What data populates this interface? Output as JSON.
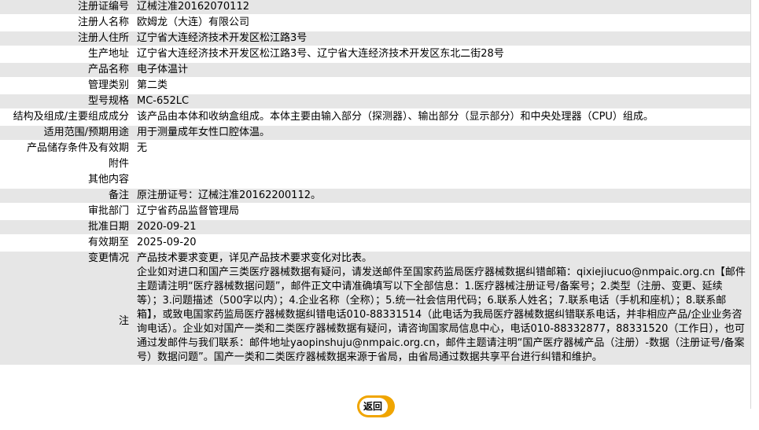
{
  "rows": [
    {
      "key": "注册证编号",
      "value": "辽械注准20162070112"
    },
    {
      "key": "注册人名称",
      "value": "欧姆龙（大连）有限公司"
    },
    {
      "key": "注册人住所",
      "value": "辽宁省大连经济技术开发区松江路3号"
    },
    {
      "key": "生产地址",
      "value": "辽宁省大连经济技术开发区松江路3号、辽宁省大连经济技术开发区东北二街28号"
    },
    {
      "key": "产品名称",
      "value": "电子体温计"
    },
    {
      "key": "管理类别",
      "value": "第二类"
    },
    {
      "key": "型号规格",
      "value": "MC-652LC"
    },
    {
      "key": "结构及组成/主要组成成分",
      "value": "该产品由本体和收纳盒组成。本体主要由输入部分（探测器）、输出部分（显示部分）和中央处理器（CPU）组成。"
    },
    {
      "key": "适用范围/预期用途",
      "value": "用于测量成年女性口腔体温。"
    },
    {
      "key": "产品储存条件及有效期",
      "value": "无"
    },
    {
      "key": "附件",
      "value": ""
    },
    {
      "key": "其他内容",
      "value": ""
    },
    {
      "key": "备注",
      "value": "原注册证号：辽械注准20162200112。"
    },
    {
      "key": "审批部门",
      "value": "辽宁省药品监督管理局"
    },
    {
      "key": "批准日期",
      "value": "2020-09-21"
    },
    {
      "key": "有效期至",
      "value": "2025-09-20"
    }
  ],
  "note": {
    "key": "注",
    "line1": "变更情况",
    "line1_value": "产品技术要求变更，详见产品技术要求变化对比表。",
    "text": "企业如对进口和国产三类医疗器械数据有疑问，请发送邮件至国家药监局医疗器械数据纠错邮箱：qixiejiucuo@nmpaic.org.cn【邮件主题请注明“医疗器械数据问题”，邮件正文中请准确填写以下全部信息：1.医疗器械注册证号/备案号；2.类型（注册、变更、延续等）；3.问题描述（500字以内）；4.企业名称（全称）；5.统一社会信用代码；6.联系人姓名；7.联系电话（手机和座机）；8.联系邮箱】，或致电国家药监局医疗器械数据纠错电话010-88331514（此电话为我局医疗器械数据纠错联系电话，并非相应产品/企业业务咨询电话）。企业如对国产一类和二类医疗器械数据有疑问，请咨询国家局信息中心，电话010-88332877，88331520（工作日），也可通过发邮件与我们联系：邮件地址yaopinshuju@nmpaic.org.cn，邮件主题请注明“国产医疗器械产品（注册）-数据（注册证号/备案号）数据问题”。国产一类和二类医疗器械数据来源于省局，由省局通过数据共享平台进行纠错和维护。"
  },
  "back_button": {
    "label": "返回"
  },
  "colors": {
    "row_alt": "#e6e6e6",
    "button_ring": "#f0a500"
  }
}
